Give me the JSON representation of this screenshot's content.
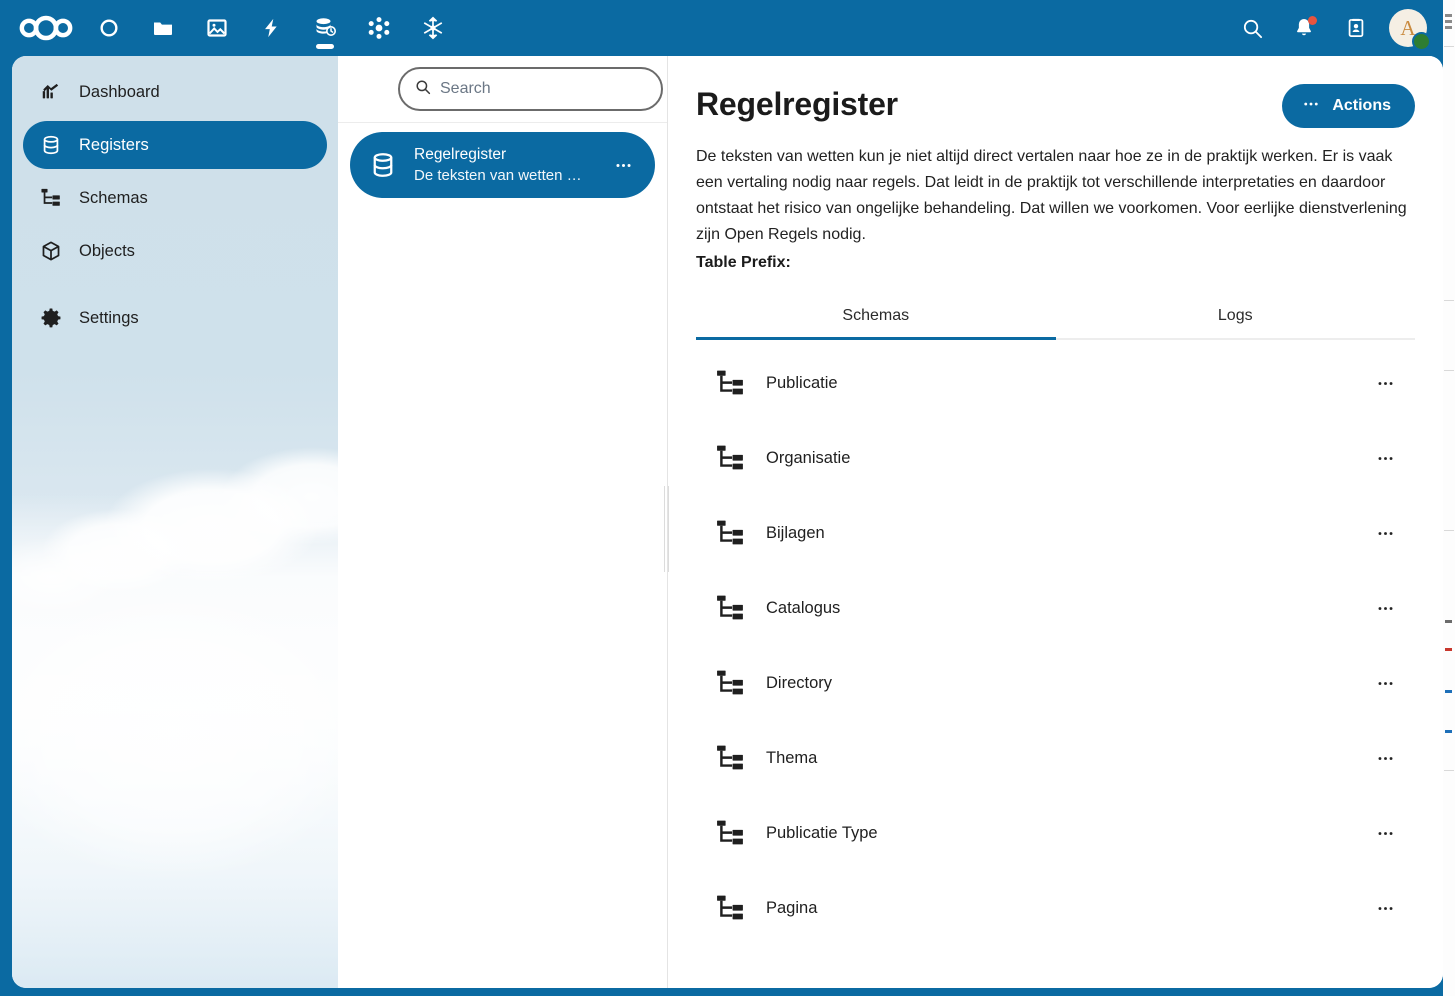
{
  "header": {
    "logo_name": "nextcloud-logo",
    "apps": [
      {
        "name": "dashboard-app-icon",
        "label": "Dashboard",
        "active": false
      },
      {
        "name": "files-app-icon",
        "label": "Files",
        "active": false
      },
      {
        "name": "photos-app-icon",
        "label": "Photos",
        "active": false
      },
      {
        "name": "activity-app-icon",
        "label": "Activity",
        "active": false
      },
      {
        "name": "openregister-app-icon",
        "label": "Open Register",
        "active": true
      },
      {
        "name": "opencatalogi-app-icon",
        "label": "Open Catalogi",
        "active": false
      },
      {
        "name": "openconnector-app-icon",
        "label": "Open Connector",
        "active": false
      }
    ],
    "right": {
      "search_label": "Search",
      "notifications_label": "Notifications",
      "contacts_label": "Contacts",
      "avatar_initial": "A",
      "status": "online"
    }
  },
  "sidebar": {
    "items": [
      {
        "label": "Dashboard",
        "icon": "chart-icon",
        "active": false
      },
      {
        "label": "Registers",
        "icon": "database-icon",
        "active": true
      },
      {
        "label": "Schemas",
        "icon": "sitemap-icon",
        "active": false
      },
      {
        "label": "Objects",
        "icon": "cube-icon",
        "active": false
      },
      {
        "label": "Settings",
        "icon": "gear-icon",
        "active": false
      }
    ]
  },
  "list": {
    "search_placeholder": "Search",
    "search_value": "",
    "menu_label": "More options",
    "registers": [
      {
        "title": "Regelregister",
        "subtitle": "De teksten van wetten …",
        "active": true
      }
    ]
  },
  "main": {
    "title": "Regelregister",
    "actions_label": "Actions",
    "description": "De teksten van wetten kun je niet altijd direct vertalen naar hoe ze in de praktijk werken. Er is vaak een vertaling nodig naar regels. Dat leidt in de praktijk tot verschillende interpretaties en daardoor ontstaat het risico van ongelijke behandeling. Dat willen we voorkomen. Voor eerlijke dienstverlening zijn Open Regels nodig.",
    "table_prefix_label": "Table Prefix:",
    "table_prefix_value": "",
    "tabs": [
      {
        "label": "Schemas",
        "active": true
      },
      {
        "label": "Logs",
        "active": false
      }
    ],
    "schemas": [
      {
        "name": "Publicatie"
      },
      {
        "name": "Organisatie"
      },
      {
        "name": "Bijlagen"
      },
      {
        "name": "Catalogus"
      },
      {
        "name": "Directory"
      },
      {
        "name": "Thema"
      },
      {
        "name": "Publicatie Type"
      },
      {
        "name": "Pagina"
      }
    ]
  },
  "colors": {
    "brand": "#0b6aa2",
    "accent": "#0b6aa2",
    "notification": "#e8543f",
    "status_online": "#2e7d32",
    "avatar_bg": "#f5efe4",
    "avatar_fg": "#c98a3e"
  }
}
